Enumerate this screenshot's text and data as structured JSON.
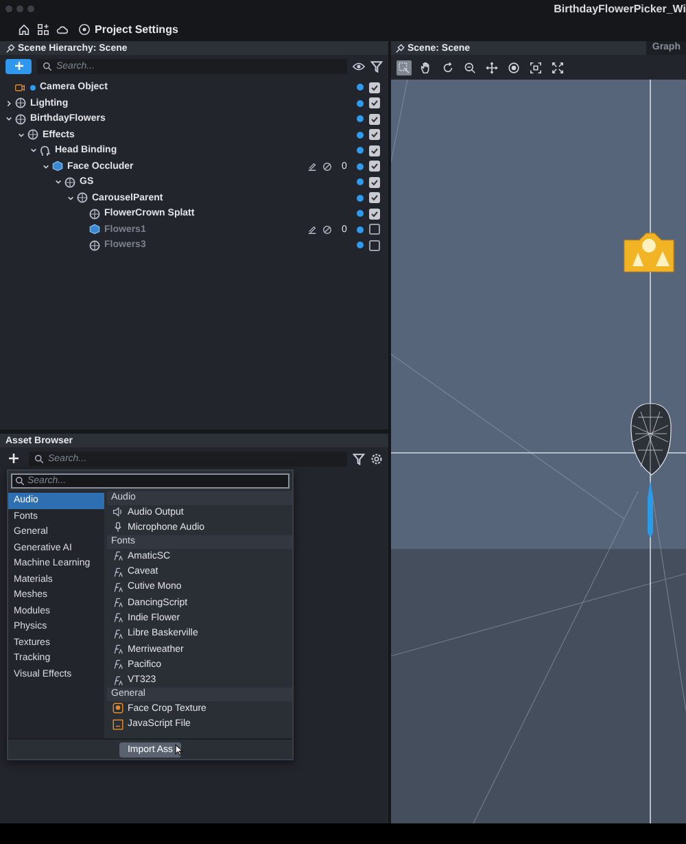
{
  "window": {
    "title": "BirthdayFlowerPicker_Wi"
  },
  "toolbar": {
    "project_settings": "Project Settings"
  },
  "hierarchy": {
    "title": "Scene Hierarchy: Scene",
    "search": {
      "placeholder": "Search..."
    },
    "items": [
      {
        "name": "Camera Object",
        "kind": "camera",
        "enabled": true
      },
      {
        "name": "Lighting",
        "kind": "object",
        "enabled": true,
        "expanded": false
      },
      {
        "name": "BirthdayFlowers",
        "kind": "object",
        "enabled": true,
        "expanded": true,
        "children": [
          {
            "name": "Effects",
            "kind": "object",
            "enabled": true,
            "expanded": true,
            "children": [
              {
                "name": "Head Binding",
                "kind": "head",
                "enabled": true,
                "expanded": true,
                "children": [
                  {
                    "name": "Face Occluder",
                    "kind": "mesh",
                    "enabled": true,
                    "expanded": true,
                    "count": "0",
                    "children": [
                      {
                        "name": "GS",
                        "kind": "object",
                        "enabled": true,
                        "expanded": true,
                        "children": [
                          {
                            "name": "CarouselParent",
                            "kind": "object",
                            "enabled": true,
                            "expanded": true,
                            "children": [
                              {
                                "name": "FlowerCrown Splatt",
                                "kind": "object",
                                "enabled": true
                              },
                              {
                                "name": "Flowers1",
                                "kind": "mesh",
                                "enabled": false,
                                "count": "0"
                              },
                              {
                                "name": "Flowers3",
                                "kind": "object",
                                "enabled": false
                              }
                            ]
                          }
                        ]
                      }
                    ]
                  }
                ]
              }
            ]
          }
        ]
      }
    ]
  },
  "scene": {
    "title": "Scene: Scene",
    "tab": "Graph",
    "tools": [
      {
        "kind": "select",
        "selected": true
      },
      {
        "kind": "pan",
        "selected": false
      },
      {
        "kind": "rotate",
        "selected": false
      },
      {
        "kind": "zoom",
        "selected": false
      },
      {
        "kind": "move",
        "selected": false
      },
      {
        "kind": "orbit",
        "selected": false
      },
      {
        "kind": "frame",
        "selected": false
      },
      {
        "kind": "expand",
        "selected": false
      }
    ]
  },
  "assets": {
    "title": "Asset Browser",
    "search": {
      "placeholder": "Search..."
    },
    "popup": {
      "search": {
        "placeholder": "Search..."
      },
      "categories": [
        {
          "label": "Audio",
          "selected": true
        },
        {
          "label": "Fonts",
          "selected": false
        },
        {
          "label": "General",
          "selected": false
        },
        {
          "label": "Generative AI",
          "selected": false
        },
        {
          "label": "Machine Learning",
          "selected": false
        },
        {
          "label": "Materials",
          "selected": false
        },
        {
          "label": "Meshes",
          "selected": false
        },
        {
          "label": "Modules",
          "selected": false
        },
        {
          "label": "Physics",
          "selected": false
        },
        {
          "label": "Textures",
          "selected": false
        },
        {
          "label": "Tracking",
          "selected": false
        },
        {
          "label": "Visual Effects",
          "selected": false
        }
      ],
      "groups": [
        {
          "title": "Audio",
          "items": [
            {
              "label": "Audio Output",
              "kind": "speaker"
            },
            {
              "label": "Microphone Audio",
              "kind": "mic"
            }
          ]
        },
        {
          "title": "Fonts",
          "items": [
            {
              "label": "AmaticSC",
              "kind": "font"
            },
            {
              "label": "Caveat",
              "kind": "font"
            },
            {
              "label": "Cutive Mono",
              "kind": "font"
            },
            {
              "label": "DancingScript",
              "kind": "font"
            },
            {
              "label": "Indie Flower",
              "kind": "font"
            },
            {
              "label": "Libre Baskerville",
              "kind": "font"
            },
            {
              "label": "Merriweather",
              "kind": "font"
            },
            {
              "label": "Pacifico",
              "kind": "font"
            },
            {
              "label": "VT323",
              "kind": "font"
            }
          ]
        },
        {
          "title": "General",
          "items": [
            {
              "label": "Face Crop Texture",
              "kind": "texture"
            },
            {
              "label": "JavaScript File",
              "kind": "script"
            }
          ]
        }
      ],
      "button": "Import Ass"
    }
  }
}
